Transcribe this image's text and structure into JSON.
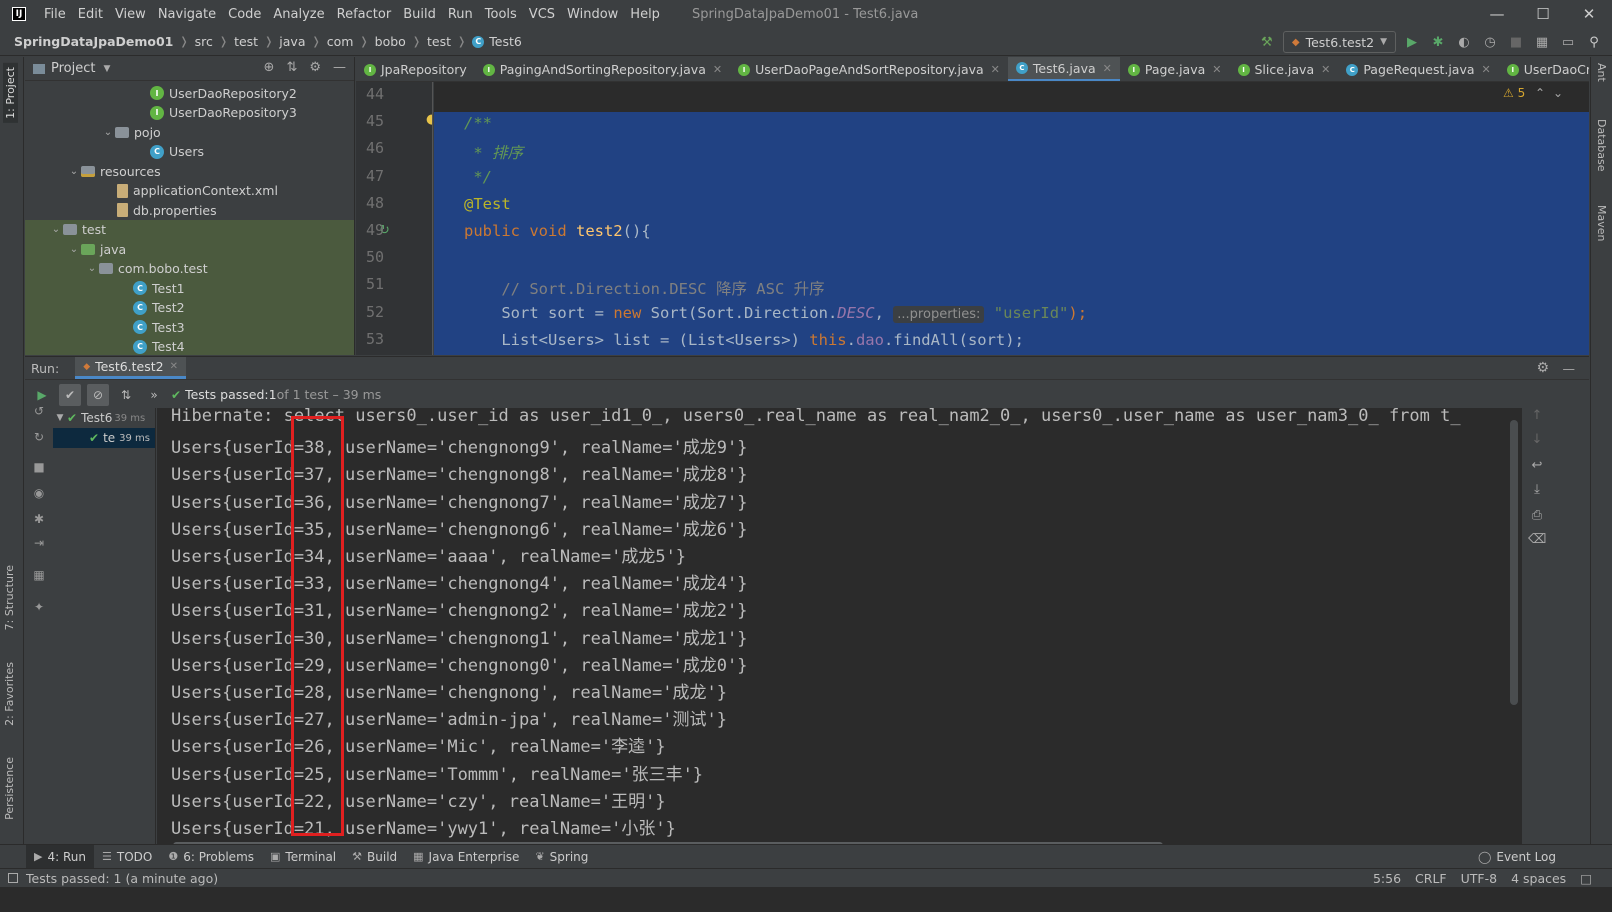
{
  "window": {
    "logo": "IJ",
    "title": "SpringDataJpaDemo01 - Test6.java",
    "menu": [
      "File",
      "Edit",
      "View",
      "Navigate",
      "Code",
      "Analyze",
      "Refactor",
      "Build",
      "Run",
      "Tools",
      "VCS",
      "Window",
      "Help"
    ]
  },
  "breadcrumb": [
    "SpringDataJpaDemo01",
    "src",
    "test",
    "java",
    "com",
    "bobo",
    "test",
    "Test6"
  ],
  "run_config": "Test6.test2",
  "left_tabs": [
    "1: Project",
    "7: Structure",
    "2: Favorites",
    "Persistence"
  ],
  "right_tabs": [
    "Ant",
    "Database",
    "Maven"
  ],
  "project": {
    "header": "Project",
    "tree": [
      {
        "label": "UserDaoRepository2",
        "icon": "interface",
        "indent": 0
      },
      {
        "label": "UserDaoRepository3",
        "icon": "interface",
        "indent": 0
      },
      {
        "label": "pojo",
        "icon": "folder",
        "indent": 1,
        "expanded": true
      },
      {
        "label": "Users",
        "icon": "class",
        "indent": 0
      },
      {
        "label": "resources",
        "icon": "resources",
        "indent": 2,
        "expanded": true
      },
      {
        "label": "applicationContext.xml",
        "icon": "file",
        "indent": 0
      },
      {
        "label": "db.properties",
        "icon": "file",
        "indent": 0
      },
      {
        "label": "test",
        "icon": "folder",
        "indent": 3,
        "expanded": true
      },
      {
        "label": "java",
        "icon": "folder-green",
        "indent": 2,
        "expanded": true
      },
      {
        "label": "com.bobo.test",
        "icon": "folder",
        "indent": 1,
        "expanded": true
      },
      {
        "label": "Test1",
        "icon": "class",
        "indent": 0
      },
      {
        "label": "Test2",
        "icon": "class",
        "indent": 0
      },
      {
        "label": "Test3",
        "icon": "class",
        "indent": 0
      },
      {
        "label": "Test4",
        "icon": "class",
        "indent": 0
      }
    ]
  },
  "editor": {
    "tabs": [
      {
        "label": "JpaRepository",
        "icon": "interface"
      },
      {
        "label": "PagingAndSortingRepository.java",
        "icon": "interface"
      },
      {
        "label": "UserDaoPageAndSortRepository.java",
        "icon": "interface"
      },
      {
        "label": "Test6.java",
        "icon": "class",
        "active": true
      },
      {
        "label": "Page.java",
        "icon": "interface"
      },
      {
        "label": "Slice.java",
        "icon": "interface"
      },
      {
        "label": "PageRequest.java",
        "icon": "class"
      },
      {
        "label": "UserDaoCru",
        "icon": "interface"
      }
    ],
    "warnings": "5",
    "line_numbers": [
      "44",
      "45",
      "46",
      "47",
      "48",
      "49",
      "50",
      "51",
      "52",
      "53"
    ],
    "code": {
      "l45": "/**",
      "l46a": " * ",
      "l46b": "排序",
      "l47": " */",
      "l48": "@Test",
      "l49_kw": "public void ",
      "l49_fn": "test2",
      "l49_end": "(){",
      "l51": "    // Sort.Direction.DESC 降序 ASC 升序",
      "l52_a": "    Sort sort = ",
      "l52_new": "new ",
      "l52_b": "Sort(Sort.Direction.",
      "l52_desc": "DESC",
      "l52_c": ", ",
      "l52_hint": "...properties:",
      "l52_str": " \"userId\"",
      "l52_end": ");",
      "l53_a": "    List<Users> list = (List<Users>) ",
      "l53_this": "this",
      "l53_b": ".",
      "l53_dao": "dao",
      "l53_c": ".findAll(sort);"
    }
  },
  "run": {
    "label": "Run:",
    "tab": "Test6.test2",
    "status_prefix": "Tests passed: ",
    "status_count": "1",
    "status_suffix": " of 1 test – 39 ms",
    "tree": [
      {
        "label": "Test6",
        "time": "39 ms"
      },
      {
        "label": "te",
        "time": "39 ms"
      }
    ],
    "console": [
      "Hibernate: select users0_.user_id as user_id1_0_, users0_.real_name as real_nam2_0_, users0_.user_name as user_nam3_0_ from t_",
      "Users{userId=38, userName='chengnong9', realName='成龙9'}",
      "Users{userId=37, userName='chengnong8', realName='成龙8'}",
      "Users{userId=36, userName='chengnong7', realName='成龙7'}",
      "Users{userId=35, userName='chengnong6', realName='成龙6'}",
      "Users{userId=34, userName='aaaa', realName='成龙5'}",
      "Users{userId=33, userName='chengnong4', realName='成龙4'}",
      "Users{userId=31, userName='chengnong2', realName='成龙2'}",
      "Users{userId=30, userName='chengnong1', realName='成龙1'}",
      "Users{userId=29, userName='chengnong0', realName='成龙0'}",
      "Users{userId=28, userName='chengnong', realName='成龙'}",
      "Users{userId=27, userName='admin-jpa', realName='测试'}",
      "Users{userId=26, userName='Mic', realName='李逵'}",
      "Users{userId=25, userName='Tommm', realName='张三丰'}",
      "Users{userId=22, userName='czy', realName='王明'}",
      "Users{userId=21, userName='ywy1', realName='小张'}"
    ]
  },
  "tool_windows": [
    {
      "label": "4: Run",
      "icon": "▶",
      "active": true
    },
    {
      "label": "TODO",
      "icon": "☰"
    },
    {
      "label": "6: Problems",
      "icon": "❶"
    },
    {
      "label": "Terminal",
      "icon": "▣"
    },
    {
      "label": "Build",
      "icon": "⚒"
    },
    {
      "label": "Java Enterprise",
      "icon": "▦"
    },
    {
      "label": "Spring",
      "icon": "❦"
    }
  ],
  "event_log": "Event Log",
  "status_bar": {
    "message": "Tests passed: 1 (a minute ago)",
    "position": "5:56",
    "line_sep": "CRLF",
    "encoding": "UTF-8",
    "indent": "4 spaces"
  },
  "colors": {
    "accent": "#4a88c7",
    "selection": "#214283",
    "highlight_box": "#e02020",
    "pass_green": "#5fb85f"
  }
}
